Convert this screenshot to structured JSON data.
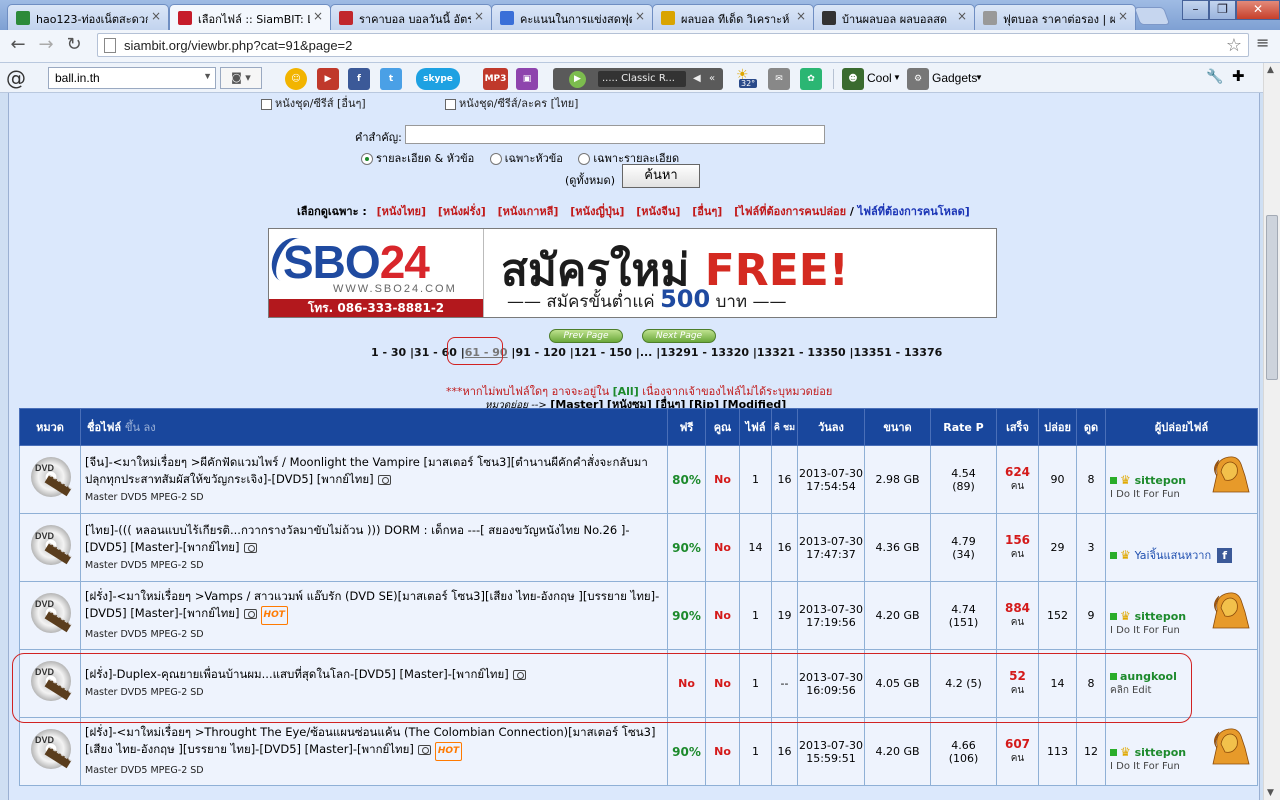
{
  "tabs": [
    {
      "title": "hao123-ท่องเน็ตสะดวก",
      "icon": "hao123-icon",
      "color": "#2d8a3a"
    },
    {
      "title": "เลือกไฟล์ :: SiamBIT: L",
      "icon": "thai-flag-icon",
      "color": "#c61c2b"
    },
    {
      "title": "ราคาบอล บอลวันนี้ อัตรา",
      "icon": "football-site-icon",
      "color": "#c1272d"
    },
    {
      "title": "คะแนนในการแข่งสดฟุต",
      "icon": "google-icon",
      "color": "#3a6fd8"
    },
    {
      "title": "ผลบอล ทีเด็ด วิเคราะห์",
      "icon": "warning-icon",
      "color": "#d9a400"
    },
    {
      "title": "บ้านผลบอล ผลบอลสด",
      "icon": "soccer-ball-icon",
      "color": "#333333"
    },
    {
      "title": "ฟุตบอล ราคาต่อรอง | ผ",
      "icon": "page-icon",
      "color": "#999999"
    }
  ],
  "address": {
    "url": "siambit.org/viewbr.php?cat=91&page=2"
  },
  "extbar": {
    "search_value": "ball.in.th",
    "player_channel": "..... Classic R...",
    "weather_temp": "32°",
    "cool_label": "Cool",
    "gadgets_label": "Gadgets",
    "skype_label": "skype",
    "mp3_label": "MP3"
  },
  "search": {
    "checkbox_a": "หนังชุด/ซีรีส์ [อื่นๆ]",
    "checkbox_b": "หนังชุด/ซีรีส์/ละคร [ไทย]",
    "keyword_label": "คำสำคัญ:",
    "radio_1": "รายละเอียด & หัวข้อ",
    "radio_2": "เฉพาะหัวข้อ",
    "radio_3": "เฉพาะรายละเอียด",
    "all_label": "(ดูทั้งหมด)",
    "button": "ค้นหา"
  },
  "filter": {
    "label": "เลือกดูเฉพาะ",
    "links": [
      "[หนังไทย]",
      "[หนังฝรั่ง]",
      "[หนังเกาหลี]",
      "[หนังญี่ปุ่น]",
      "[หนังจีน]",
      "[อื่นๆ]"
    ],
    "wanted_a": "[ไฟล์ที่ต้องการคนปล่อย",
    "wanted_sep": " / ",
    "wanted_b": "ไฟล์ที่ต้องการคนโหลด]"
  },
  "banner": {
    "logo_a": "SBO",
    "logo_b": "24",
    "www": "WWW.SBO24.COM",
    "tel": "โทร. 086-333-8881-2",
    "promo": "สมัครใหม่",
    "promo_free": "FREE!",
    "promo2_a": "—— สมัครขั้นต่ำแค่",
    "promo2_amt": "500",
    "promo2_b": "บาท ——"
  },
  "pager": {
    "prev": "Prev Page",
    "next": "Next Page",
    "ranges": [
      "1 - 30",
      "31 - 60",
      "61 - 90",
      "91 - 120",
      "121 - 150",
      "...",
      "13291 - 13320",
      "13321 - 13350",
      "13351 - 13376"
    ],
    "current": "61 - 90"
  },
  "notice": {
    "text_a": "***หากไม่พบไฟล์ใดๆ อาจจะอยู่ใน",
    "all": "[All]",
    "text_b": "เนื่องจากเจ้าของไฟล์ไม่ได้ระบุหมวดย่อย"
  },
  "subcat": {
    "label": "หมวดย่อย -->",
    "items": [
      "[Master]",
      "[หนังซูม]",
      "[อื่นๆ]",
      "[Rip]",
      "[Modified]"
    ]
  },
  "table": {
    "headers": {
      "cat": "หมวด",
      "name": "ชื่อไฟล์",
      "name_sort": "ขึ้น ลง",
      "free": "ฟรี",
      "quality": "คูณ",
      "files": "ไฟล์",
      "comments": "คิ ชม",
      "date": "วันลง",
      "size": "ขนาด",
      "rate": "Rate P",
      "done": "เสร็จ",
      "seed": "ปล่อย",
      "leech": "ดูด",
      "uploader": "ผู้ปล่อยไฟล์"
    },
    "rows": [
      {
        "title": "[จีน]-<มาใหม่เรื่อยๆ >ผีคักฟัดแวมไพร์ / Moonlight the Vampire [มาสเตอร์ โซน3][ตำนานผีคักคำสั่งจะกลับมาปลุกทุกประสาทสัมผัสให้ขวัญกระเจิง]-[DVD5] [พากย์ไทย]",
        "meta": "Master   DVD5   MPEG-2   SD",
        "hot": false,
        "free": "80%",
        "quality": "No",
        "files": "1",
        "comments": "16",
        "date": "2013-07-30",
        "time": "17:54:54",
        "size": "2.98 GB",
        "rate": "4.54",
        "votes": "(89)",
        "done": "624",
        "done_unit": "คน",
        "seed": "90",
        "leech": "8",
        "uploader": "sittepon",
        "slogan": "I Do It For Fun",
        "avatar": "lion"
      },
      {
        "title": "[ไทย]-((( หลอนแบบไร้เกียรติ...กวากรางวัลมาขับไม่ถ้วน ))) DORM : เด็กหอ ---[ สยองขวัญหนังไทย No.26 ]-[DVD5] [Master]-[พากย์ไทย]",
        "meta": "Master   DVD5   MPEG-2   SD",
        "hot": false,
        "free": "90%",
        "quality": "No",
        "files": "14",
        "comments": "16",
        "date": "2013-07-30",
        "time": "17:47:37",
        "size": "4.36 GB",
        "rate": "4.79",
        "votes": "(34)",
        "done": "156",
        "done_unit": "คน",
        "seed": "29",
        "leech": "3",
        "uploader": "Yaiจิ้นแสนหวาก",
        "slogan": "",
        "avatar": "facebook"
      },
      {
        "title": "[ฝรั่ง]-<มาใหม่เรื่อยๆ >Vamps / สาวแวมพ์ แอ๊บรัก (DVD SE)[มาสเตอร์ โซน3][เสียง ไทย-อังกฤษ ][บรรยาย ไทย]-[DVD5] [Master]-[พากย์ไทย]",
        "meta": "Master   DVD5   MPEG-2   SD",
        "hot": true,
        "free": "90%",
        "quality": "No",
        "files": "1",
        "comments": "19",
        "date": "2013-07-30",
        "time": "17:19:56",
        "size": "4.20 GB",
        "rate": "4.74",
        "votes": "(151)",
        "done": "884",
        "done_unit": "คน",
        "seed": "152",
        "leech": "9",
        "uploader": "sittepon",
        "slogan": "I Do It For Fun",
        "avatar": "lion"
      },
      {
        "title": "[ฝรั่ง]-Duplex-คุณยายเพื่อนบ้านผม...แสบที่สุดในโลก-[DVD5] [Master]-[พากย์ไทย]",
        "meta": "Master DVD5     MPEG-2     SD",
        "hot": false,
        "free": "No",
        "quality": "No",
        "files": "1",
        "comments": "--",
        "date": "2013-07-30",
        "time": "16:09:56",
        "size": "4.05 GB",
        "rate": "4.2 (5)",
        "votes": "",
        "done": "52",
        "done_unit": "คน",
        "seed": "14",
        "leech": "8",
        "uploader": "aungkool",
        "slogan": "คลิก Edit",
        "avatar": "none"
      },
      {
        "title": "[ฝรั่ง]-<มาใหม่เรื่อยๆ >Throught The Eye/ซ้อนแผนซ่อนแค้น (The Colombian Connection)[มาสเตอร์ โซน3][เสียง ไทย-อังกฤษ ][บรรยาย ไทย]-[DVD5] [Master]-[พากย์ไทย]",
        "meta": "Master   DVD5   MPEG-2   SD",
        "hot": true,
        "free": "90%",
        "quality": "No",
        "files": "1",
        "comments": "16",
        "date": "2013-07-30",
        "time": "15:59:51",
        "size": "4.20 GB",
        "rate": "4.66",
        "votes": "(106)",
        "done": "607",
        "done_unit": "คน",
        "seed": "113",
        "leech": "12",
        "uploader": "sittepon",
        "slogan": "I Do It For Fun",
        "avatar": "lion"
      }
    ]
  },
  "colors": {
    "header_blue": "#19479d",
    "free_green": "#1d8a2c",
    "alert_red": "#d41a1a"
  }
}
